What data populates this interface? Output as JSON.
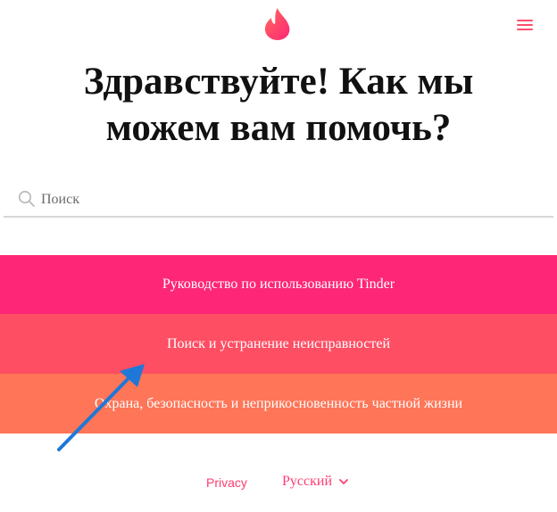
{
  "header": {
    "logo_icon": "tinder-flame-icon",
    "menu_icon": "hamburger-menu-icon"
  },
  "hero": {
    "title": "Здравствуйте! Как мы можем вам помочь?"
  },
  "search": {
    "placeholder": "Поиск",
    "value": "",
    "icon": "search-icon"
  },
  "categories": [
    {
      "label": "Руководство по использованию Tinder",
      "color": "#fe2676"
    },
    {
      "label": "Поиск и устранение неисправностей",
      "color": "#fe4e63"
    },
    {
      "label": "Охрана, безопасность и неприкосновенность частной жизни",
      "color": "#fe7557"
    }
  ],
  "annotation": {
    "icon": "blue-arrow-pointer",
    "color": "#1f78d8"
  },
  "footer": {
    "privacy_label": "Privacy",
    "language": "Русский",
    "language_icon": "chevron-down-icon"
  },
  "colors": {
    "accent": "#fe3c72"
  }
}
